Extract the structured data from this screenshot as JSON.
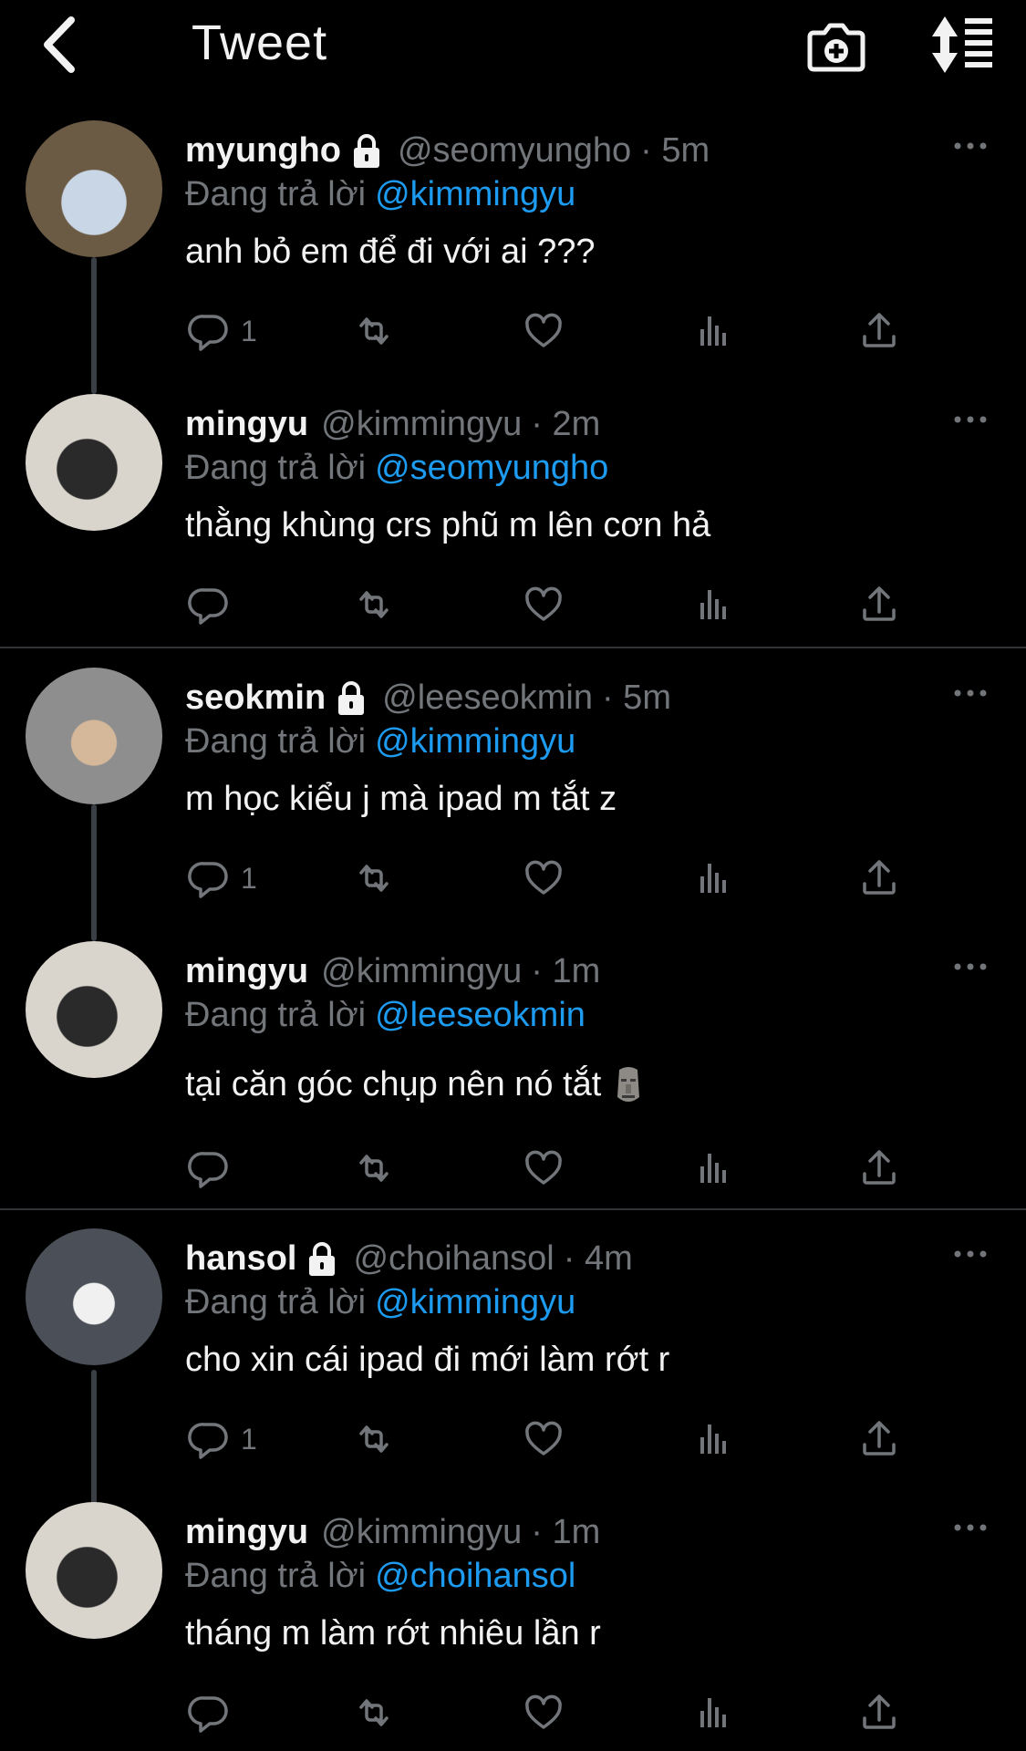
{
  "header": {
    "title": "Tweet"
  },
  "icons": {
    "back": "chevron-left-icon",
    "camera": "camera-add-icon",
    "sort": "sort-icon",
    "reply": "reply-icon",
    "retweet": "retweet-icon",
    "like": "heart-icon",
    "views": "views-icon",
    "share": "share-icon",
    "more": "more-icon",
    "lock": "lock-icon"
  },
  "colors": {
    "background": "#000000",
    "text": "#f2f2f2",
    "secondary": "#72767a",
    "accent": "#1d9bf0",
    "divider": "#2f3336"
  },
  "replying_label": "Đang trả lời",
  "tweets": [
    {
      "name": "myungho",
      "handle": "@seomyungho",
      "time": "· 5m",
      "replying_to": "@kimmingyu",
      "text": "anh bỏ em để đi với ai ???",
      "reply_count": "1",
      "locked": true
    },
    {
      "name": "mingyu",
      "handle": "@kimmingyu",
      "time": "· 2m",
      "replying_to": "@seomyungho",
      "text": "thằng khùng crs phũ m lên cơn hả",
      "reply_count": "",
      "locked": false
    },
    {
      "name": "seokmin",
      "handle": "@leeseokmin",
      "time": "· 5m",
      "replying_to": "@kimmingyu",
      "text": "m học kiểu j mà ipad m tắt z",
      "reply_count": "1",
      "locked": true
    },
    {
      "name": "mingyu",
      "handle": "@kimmingyu",
      "time": "· 1m",
      "replying_to": "@leeseokmin",
      "text": "tại căn góc chụp nên nó tắt",
      "emoji": "moai-icon",
      "reply_count": "",
      "locked": false
    },
    {
      "name": "hansol",
      "handle": "@choihansol",
      "time": "· 4m",
      "replying_to": "@kimmingyu",
      "text": "cho xin cái ipad đi mới làm rớt r",
      "reply_count": "1",
      "locked": true
    },
    {
      "name": "mingyu",
      "handle": "@kimmingyu",
      "time": "· 1m",
      "replying_to": "@choihansol",
      "text": "tháng m làm rớt nhiêu lần r",
      "reply_count": "",
      "locked": false
    }
  ]
}
